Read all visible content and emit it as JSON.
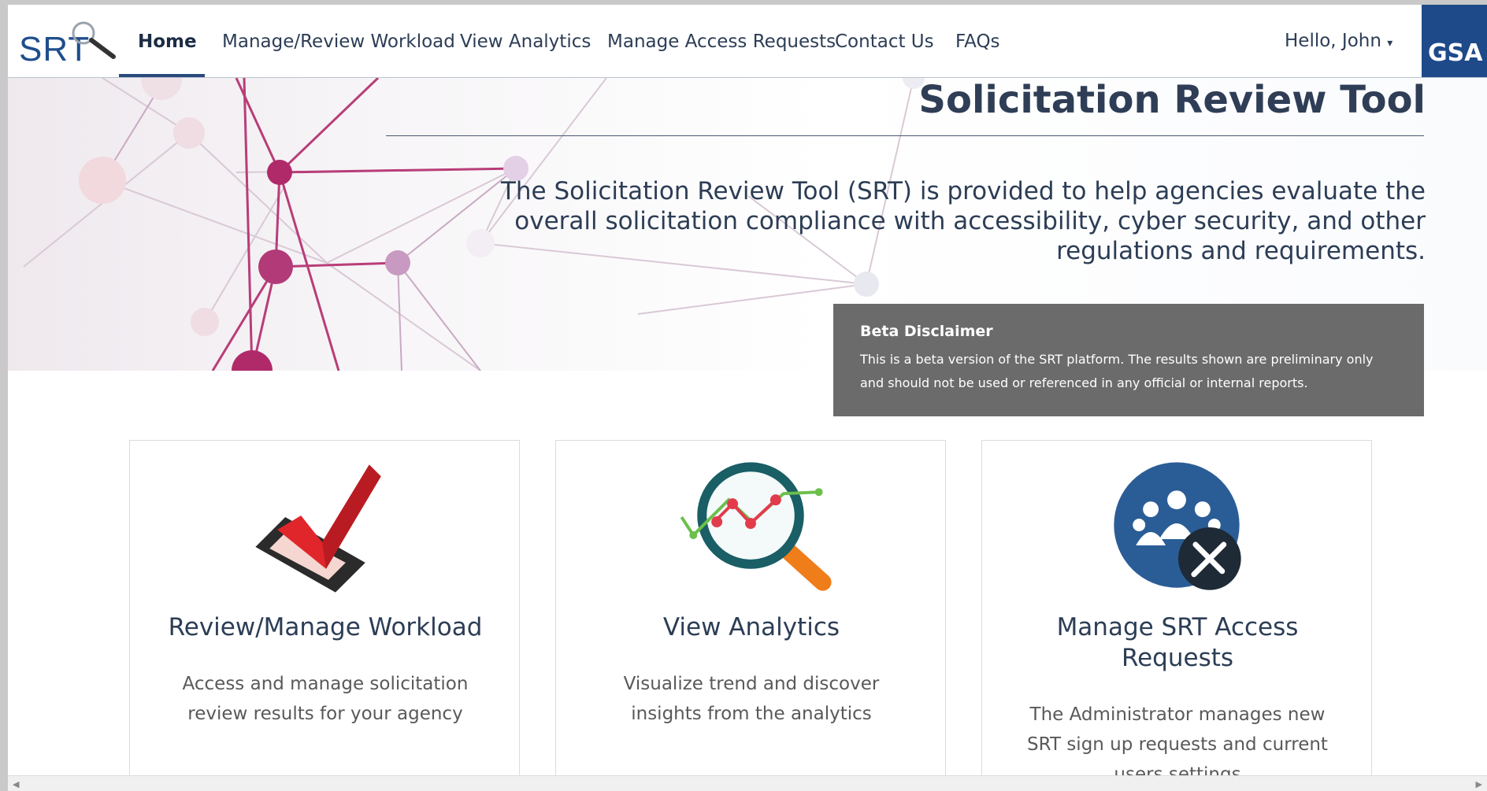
{
  "nav": {
    "logo": "SRT",
    "items": [
      "Home",
      "Manage/Review Workload",
      "View Analytics",
      "Manage Access Requests",
      "Contact Us",
      "FAQs"
    ],
    "active": "Home",
    "greeting": "Hello, John",
    "brand": "GSA"
  },
  "hero": {
    "title": "Solicitation Review Tool",
    "description": "The Solicitation Review Tool (SRT) is provided to help agencies evaluate the overall solicitation compliance with accessibility, cyber security, and other regulations and requirements."
  },
  "beta": {
    "title": "Beta Disclaimer",
    "text": "This is a beta version of the SRT platform. The results shown are preliminary only and should not be used or referenced in any official or internal reports."
  },
  "cards": [
    {
      "title": "Review/Manage Workload",
      "text": "Access and manage solicitation review results for your agency",
      "icon": "checkmark-icon"
    },
    {
      "title": "View Analytics",
      "text": "Visualize trend and discover insights from the analytics",
      "icon": "analytics-magnifier-icon"
    },
    {
      "title": "Manage SRT Access Requests",
      "text": "The Administrator manages new SRT sign up requests and current users settings",
      "icon": "user-admin-icon"
    }
  ],
  "colors": {
    "brand": "#1f4a8a",
    "text": "#2c3d55",
    "disclaimer_bg": "#6b6b6b",
    "accent": "#b12a6b"
  }
}
